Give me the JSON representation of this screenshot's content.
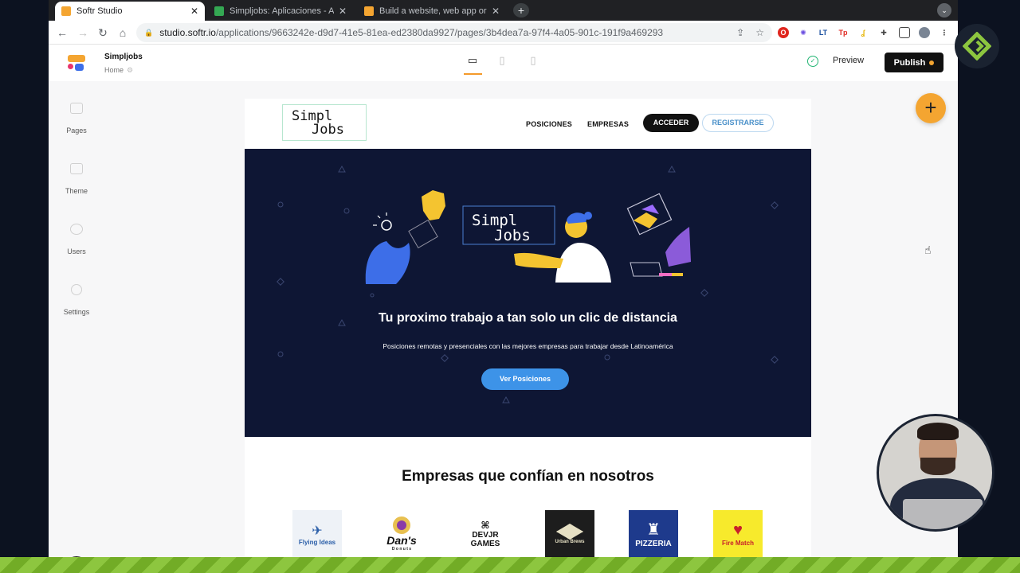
{
  "browser": {
    "tabs": [
      {
        "title": "Softr Studio",
        "favicon_color": "#f4a531",
        "active": true
      },
      {
        "title": "Simpljobs: Aplicaciones - Airta",
        "favicon_color": "#34a853",
        "active": false
      },
      {
        "title": "Build a website, web app or po",
        "favicon_color": "#f4a531",
        "active": false
      }
    ],
    "url_host": "studio.softr.io",
    "url_path": "/applications/9663242e-d9d7-41e5-81ea-ed2380da9927/pages/3b4dea7a-97f4-4a05-901c-191f9a469293"
  },
  "studio": {
    "app_name": "Simpljobs",
    "page_name": "Home",
    "preview_label": "Preview",
    "publish_label": "Publish",
    "sidebar": [
      {
        "label": "Pages",
        "icon": "pages-icon"
      },
      {
        "label": "Theme",
        "icon": "theme-icon"
      },
      {
        "label": "Users",
        "icon": "users-icon"
      },
      {
        "label": "Settings",
        "icon": "settings-icon"
      }
    ],
    "active_device": "desktop",
    "colors": {
      "accent": "#f4a531",
      "publish_bg": "#111111"
    }
  },
  "site": {
    "logo_line1": "Simpl",
    "logo_line2": "Jobs",
    "nav": [
      "POSICIONES",
      "EMPRESAS"
    ],
    "acceder_label": "ACCEDER",
    "registrarse_label": "REGISTRARSE",
    "hero": {
      "title": "Tu proximo trabajo a tan solo un clic de distancia",
      "subtitle": "Posiciones remotas y presenciales con las mejores empresas para trabajar desde Latinoamérica",
      "button": "Ver Posiciones",
      "background": "#0e1634"
    },
    "companies_title": "Empresas que confían en nosotros",
    "companies": [
      {
        "name": "Flying Ideas",
        "bg": "#eef2f7",
        "fg": "#2a5ea8"
      },
      {
        "name": "Dan's",
        "sub": "D o n u t s",
        "bg": "#ffffff",
        "fg": "#111111"
      },
      {
        "name": "DEVJR",
        "sub": "GAMES",
        "bg": "#ffffff",
        "fg": "#111111"
      },
      {
        "name": "Urban Brews",
        "bg": "#1d1d1d",
        "fg": "#e6e0c4"
      },
      {
        "name": "PIZZERIA",
        "bg": "#1e3a8c",
        "fg": "#ffffff"
      },
      {
        "name": "Fire Match",
        "bg": "#f7ea2c",
        "fg": "#c8202b"
      }
    ]
  }
}
